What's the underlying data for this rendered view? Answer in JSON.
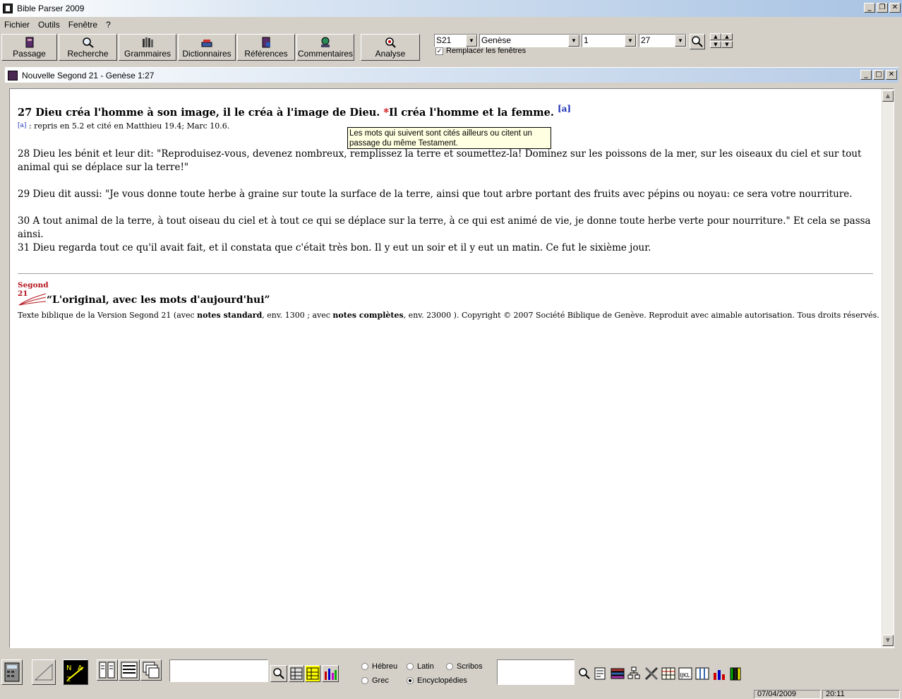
{
  "app": {
    "title": "Bible Parser 2009"
  },
  "menu": [
    "Fichier",
    "Outils",
    "Fenêtre",
    "?"
  ],
  "toolbar": {
    "buttons": [
      "Passage",
      "Recherche",
      "Grammaires",
      "Dictionnaires",
      "Références",
      "Commentaires",
      "Analyse"
    ],
    "version": "S21",
    "book": "Genèse",
    "chapter": "1",
    "verse": "27",
    "replace_windows_label": "Remplacer les fenêtres",
    "replace_windows_checked": true
  },
  "child_window": {
    "title": "Nouvelle Segond 21 - Genèse 1:27"
  },
  "passage": {
    "v27_num": "27",
    "v27_text": " Dieu créa l'homme à son image, il le créa à l'image de Dieu. ",
    "v27_star": "*",
    "v27_text2": "Il créa l'homme et la femme. ",
    "v27_fnref": "[a]",
    "footnote_ref": "[a]",
    "footnote_text": " : repris en 5.2 et cité en Matthieu 19.4; Marc 10.6.",
    "v28": "28 Dieu les bénit et leur dit: \"Reproduisez-vous, devenez nombreux, remplissez la terre et soumettez-la! Dominez sur les poissons de la mer, sur les oiseaux du ciel et sur tout animal qui se déplace sur la terre!\"",
    "v29": "29 Dieu dit aussi: \"Je vous donne toute herbe à graine sur toute la surface de la terre, ainsi que tout arbre portant des fruits avec pépins ou noyau: ce sera votre nourriture.",
    "v30": "30 A tout animal de la terre, à tout oiseau du ciel et à tout ce qui se déplace sur la terre, à ce qui est animé de vie, je donne toute herbe verte pour nourriture.\" Et cela se passa ainsi.",
    "v31": "31 Dieu regarda tout ce qu'il avait fait, et il constata que c'était très bon. Il y eut un soir et il y eut un matin. Ce fut le sixième jour.",
    "logo_line1": "Segond",
    "logo_line2": "21",
    "slogan": "“L'original, avec les mots d'aujourd'hui”",
    "copyright_a": "Texte biblique de la Version Segond 21 (avec ",
    "copyright_b": "notes standard",
    "copyright_c": ", env. 1300 ; avec ",
    "copyright_d": "notes complètes",
    "copyright_e": ", env. 23000 ). Copyright © 2007 Société Biblique de Genève. Reproduit avec aimable autorisation. Tous droits réservés."
  },
  "tooltip": "Les mots qui suivent sont cités ailleurs ou citent un passage du même Testament.",
  "bottom": {
    "radios": [
      {
        "label": "Hébreu",
        "checked": false
      },
      {
        "label": "Latin",
        "checked": false
      },
      {
        "label": "Scribos",
        "checked": false
      },
      {
        "label": "Grec",
        "checked": false
      },
      {
        "label": "Encyclopédies",
        "checked": true
      }
    ]
  },
  "status": {
    "date": "07/04/2009",
    "time": "20:11"
  }
}
